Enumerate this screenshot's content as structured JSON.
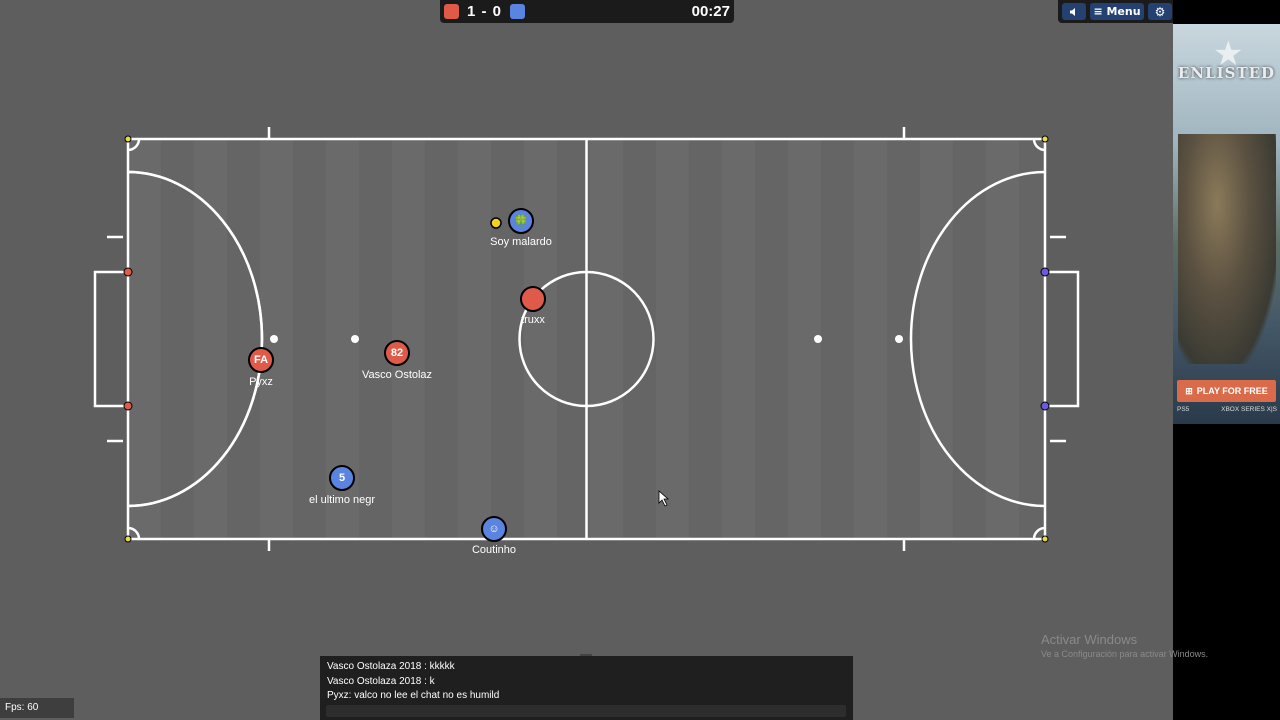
{
  "scoreboard": {
    "red_color": "#e05a4a",
    "blue_color": "#5b84e0",
    "score": "1 - 0",
    "time": "00:27"
  },
  "controls": {
    "sound_icon": "speaker-icon",
    "menu_label": "≡ Menu",
    "settings_icon": "gear-icon"
  },
  "players": [
    {
      "name": "Soy malardo",
      "team": "blue",
      "avatar": "🍀"
    },
    {
      "name": "truxx",
      "team": "red",
      "avatar": ""
    },
    {
      "name": "Vasco Ostolaz",
      "team": "red",
      "avatar": "82"
    },
    {
      "name": "Pyxz",
      "team": "red",
      "avatar": "FA"
    },
    {
      "name": "el ultimo negr",
      "team": "blue",
      "avatar": "5"
    },
    {
      "name": "Coutinho",
      "team": "blue",
      "avatar": "☺"
    }
  ],
  "chat": {
    "messages": [
      "Vasco Ostolaza 2018 : kkkkk",
      "Vasco Ostolaza 2018 : k",
      "Pyxz: valco no lee el chat no es humild"
    ]
  },
  "fps": "Fps: 60",
  "watermark": {
    "title": "Activar Windows",
    "subtitle": "Ve a Configuración para activar Windows."
  },
  "ad": {
    "logo": "ENLISTED",
    "cta": "PLAY FOR FREE",
    "platform_left": "PS5",
    "platform_right": "XBOX SERIES X|S"
  }
}
